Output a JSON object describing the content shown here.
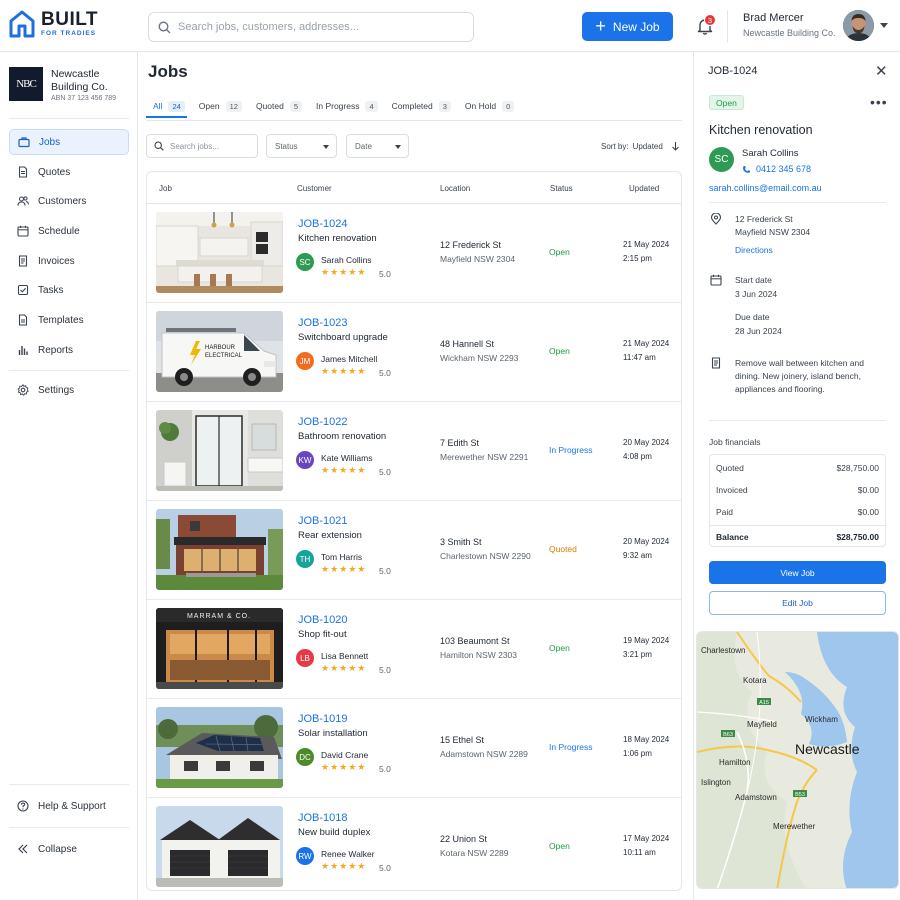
{
  "brand": {
    "name": "BUILT",
    "tagline": "FOR TRADIES"
  },
  "search": {
    "placeholder": "Search jobs, customers, addresses..."
  },
  "header": {
    "new_job_label": "New Job",
    "notification_count": "3",
    "user_name": "Brad Mercer",
    "user_org": "Newcastle Building Co."
  },
  "org": {
    "initials": "NBC",
    "name_line1": "Newcastle",
    "name_line2": "Building Co.",
    "abn": "ABN 37 123 456 789"
  },
  "sidebar": {
    "items": [
      {
        "label": "Jobs",
        "icon": "briefcase-icon",
        "active": true
      },
      {
        "label": "Quotes",
        "icon": "document-icon"
      },
      {
        "label": "Customers",
        "icon": "users-icon"
      },
      {
        "label": "Schedule",
        "icon": "calendar-icon"
      },
      {
        "label": "Invoices",
        "icon": "invoice-icon"
      },
      {
        "label": "Tasks",
        "icon": "checkbox-icon"
      },
      {
        "label": "Templates",
        "icon": "template-icon"
      },
      {
        "label": "Reports",
        "icon": "bar-chart-icon"
      }
    ],
    "settings_label": "Settings",
    "help_label": "Help & Support",
    "collapse_label": "Collapse"
  },
  "main": {
    "title": "Jobs",
    "tabs": [
      {
        "label": "All",
        "count": "24"
      },
      {
        "label": "Open",
        "count": "12"
      },
      {
        "label": "Quoted",
        "count": "5"
      },
      {
        "label": "In Progress",
        "count": "4"
      },
      {
        "label": "Completed",
        "count": "3"
      },
      {
        "label": "On Hold",
        "count": "0"
      }
    ],
    "filter_search_placeholder": "Search jobs...",
    "filter_status": "Status",
    "filter_date": "Date",
    "sort_label": "Sort by:",
    "sort_value": "Updated",
    "columns": {
      "job": "Job",
      "customer": "Customer",
      "location": "Location",
      "status": "Status",
      "updated": "Updated"
    }
  },
  "jobs": [
    {
      "id": "JOB-1024",
      "title": "Kitchen renovation",
      "initials": "SC",
      "customer": "Sarah Collins",
      "avatar_color": "#2e9a53",
      "rating": "5.0",
      "street": "12 Frederick St",
      "suburb": "Mayfield NSW 2304",
      "status": "Open",
      "date": "21 May 2024",
      "time": "2:15 pm"
    },
    {
      "id": "JOB-1023",
      "title": "Switchboard upgrade",
      "initials": "JM",
      "customer": "James Mitchell",
      "avatar_color": "#f26b21",
      "rating": "5.0",
      "street": "48 Hannell St",
      "suburb": "Wickham NSW 2293",
      "status": "Open",
      "date": "21 May 2024",
      "time": "11:47 am",
      "van_text_1": "HARBOUR",
      "van_text_2": "ELECTRICAL"
    },
    {
      "id": "JOB-1022",
      "title": "Bathroom renovation",
      "initials": "KW",
      "customer": "Kate Williams",
      "avatar_color": "#6a45c2",
      "rating": "5.0",
      "street": "7 Edith St",
      "suburb": "Merewether NSW 2291",
      "status": "In Progress",
      "date": "20 May 2024",
      "time": "4:08 pm"
    },
    {
      "id": "JOB-1021",
      "title": "Rear extension",
      "initials": "TH",
      "customer": "Tom Harris",
      "avatar_color": "#16a39a",
      "rating": "5.0",
      "street": "3 Smith St",
      "suburb": "Charlestown NSW 2290",
      "status": "Quoted",
      "date": "20 May 2024",
      "time": "9:32 am"
    },
    {
      "id": "JOB-1020",
      "title": "Shop fit-out",
      "initials": "LB",
      "customer": "Lisa Bennett",
      "avatar_color": "#e53945",
      "rating": "5.0",
      "street": "103 Beaumont St",
      "suburb": "Hamilton NSW 2303",
      "status": "Open",
      "date": "19 May 2024",
      "time": "3:21 pm",
      "shop_sign": "MARRAM & CO."
    },
    {
      "id": "JOB-1019",
      "title": "Solar installation",
      "initials": "DC",
      "customer": "David Crane",
      "avatar_color": "#4d8a2a",
      "rating": "5.0",
      "street": "15 Ethel St",
      "suburb": "Adamstown NSW 2289",
      "status": "In Progress",
      "date": "18 May 2024",
      "time": "1:06 pm"
    },
    {
      "id": "JOB-1018",
      "title": "New build duplex",
      "initials": "RW",
      "customer": "Renee Walker",
      "avatar_color": "#1a73e8",
      "rating": "5.0",
      "street": "22 Union St",
      "suburb": "Kotara NSW 2289",
      "status": "Open",
      "date": "17 May 2024",
      "time": "10:11 am"
    }
  ],
  "stars": "★★★★★",
  "detail": {
    "job_id": "JOB-1024",
    "status": "Open",
    "title": "Kitchen renovation",
    "initials": "SC",
    "customer": "Sarah Collins",
    "phone": "0412 345 678",
    "email": "sarah.collins@email.com.au",
    "address_line1": "12 Frederick St",
    "address_line2": "Mayfield NSW 2304",
    "directions_label": "Directions",
    "start_label": "Start date",
    "start_value": "3 Jun 2024",
    "due_label": "Due date",
    "due_value": "28 Jun 2024",
    "notes": "Remove wall between kitchen and dining. New joinery, island bench, appliances and flooring.",
    "financials_heading": "Job financials",
    "financials": [
      {
        "label": "Quoted",
        "value": "$28,750.00"
      },
      {
        "label": "Invoiced",
        "value": "$0.00"
      },
      {
        "label": "Paid",
        "value": "$0.00"
      },
      {
        "label": "Balance",
        "value": "$28,750.00"
      }
    ],
    "view_label": "View Job",
    "edit_label": "Edit Job"
  },
  "map": {
    "labels": [
      "Charlestown",
      "Kotara",
      "Mayfield",
      "Wickham",
      "Newcastle",
      "Hamilton",
      "Islington",
      "Adamstown",
      "Merewether"
    ],
    "road_labels": [
      "A15",
      "B63",
      "B53"
    ]
  },
  "colors": {
    "accent": "#1a73e8",
    "open": "#1e9a45",
    "in_progress": "#1a73e8",
    "quoted": "#e07b00",
    "star": "#f5a623"
  }
}
